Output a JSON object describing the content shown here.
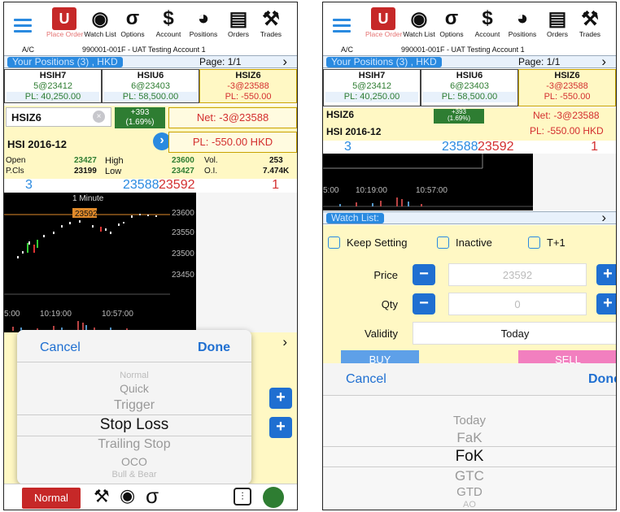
{
  "toolbar": {
    "logo_text": "U",
    "place_order": "Place Order",
    "watch_list": "Watch List",
    "options": "Options",
    "account": "Account",
    "positions": "Positions",
    "orders": "Orders",
    "trades": "Trades",
    "glyph_sigma": "σ",
    "glyph_eye": "👁",
    "glyph_gavel": "⚖"
  },
  "account": {
    "label": "A/C",
    "value": "990001-001F - UAT Testing Account 1"
  },
  "positions": {
    "tab": "Your Positions (3) , HKD",
    "page": "Page: 1/1",
    "chevron": "›"
  },
  "position_cells": [
    {
      "name": "HSIH7",
      "qty": "5@23412",
      "pl": "PL: 40,250.00"
    },
    {
      "name": "HSIU6",
      "qty": "6@23403",
      "pl": "PL: 58,500.00"
    },
    {
      "name": "HSIZ6",
      "qty": "-3@23588",
      "pl": "PL: -550.00"
    }
  ],
  "symbol": {
    "code": "HSIZ6",
    "series": "HSI 2016-12",
    "change": "+393",
    "change_pct": "(1.69%)",
    "net": "Net: -3@23588",
    "pl_left": "PL: -550.00 HKD",
    "pl_right": "PL: -550.00 HKD",
    "clear_icon": "×",
    "go_icon": "›"
  },
  "stats": {
    "open_label": "Open",
    "open": "23427",
    "high_label": "High",
    "high": "23600",
    "vol_label": "Vol.",
    "vol": "253",
    "pcls_label": "P.Cls",
    "pcls": "23199",
    "low_label": "Low",
    "low": "23427",
    "oi_label": "O.I.",
    "oi": "7.474K"
  },
  "quote": {
    "bid_count": "3",
    "bid": "23588",
    "ask": "23592",
    "ask_count": "1"
  },
  "chart": {
    "title": "1 Minute",
    "last_price": "23592",
    "y_ticks": [
      "23600",
      "23550",
      "23500",
      "23450"
    ],
    "x_ticks": [
      "5:00",
      "10:19:00",
      "10:57:00"
    ]
  },
  "picker1": {
    "cancel": "Cancel",
    "done": "Done",
    "options": [
      "Normal",
      "Quick",
      "Trigger",
      "Stop Loss",
      "Trailing Stop",
      "OCO",
      "Bull & Bear"
    ],
    "selected_index": 3
  },
  "bottom_bar": {
    "order_type": "Normal",
    "sigma": "σ",
    "gavel": "⚖",
    "eye": "👁",
    "settings": "⚙"
  },
  "watch": {
    "tab": "Watch List:",
    "chevron": "›"
  },
  "order": {
    "keep_setting": "Keep Setting",
    "inactive": "Inactive",
    "t_plus_1": "T+1",
    "price_label": "Price",
    "price_value": "23592",
    "qty_label": "Qty",
    "qty_value": "0",
    "validity_label": "Validity",
    "validity_value": "Today",
    "buy": "BUY",
    "sell": "SELL",
    "minus": "−",
    "plus": "+"
  },
  "picker2": {
    "cancel": "Cancel",
    "done": "Done",
    "options": [
      "Today",
      "FaK",
      "FoK",
      "GTC",
      "GTD",
      "AO"
    ],
    "selected_index": 2
  },
  "colors": {
    "accent": "#2a8ae0",
    "up": "#2e7d32",
    "down": "#d32f2f",
    "panel": "#fff8c4"
  }
}
